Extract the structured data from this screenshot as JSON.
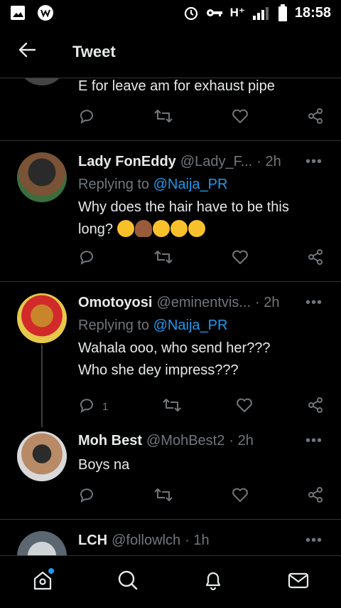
{
  "status_bar": {
    "network": "H⁺",
    "time": "18:58"
  },
  "header": {
    "title": "Tweet"
  },
  "tweets": [
    {
      "text": "E for leave am for exhaust pipe"
    },
    {
      "name": "Lady FonEddy",
      "handle": "@Lady_F...",
      "time": "· 2h",
      "replying_label": "Replying to ",
      "replying_handle": "@Naija_PR",
      "text": "Why does the hair have to be this long?"
    },
    {
      "name": "Omotoyosi",
      "handle": "@eminentvis...",
      "time": "· 2h",
      "replying_label": "Replying to ",
      "replying_handle": "@Naija_PR",
      "text_line1": "Wahala ooo, who send her???",
      "text_line2": "Who she dey impress???",
      "reply_count": "1"
    },
    {
      "name": "Moh Best",
      "handle": "@MohBest2",
      "time": "· 2h",
      "text": "Boys na"
    },
    {
      "name": "LCH",
      "handle": "@followlch",
      "time": "· 1h"
    }
  ],
  "more_label": "•••",
  "icons": [
    "back-arrow-icon",
    "home-icon",
    "search-icon",
    "bell-icon",
    "mail-icon",
    "reply-icon",
    "retweet-icon",
    "like-icon",
    "share-icon"
  ],
  "colors": {
    "background": "#000000",
    "text": "#e7e9ea",
    "secondary": "#71767b",
    "accent": "#1d9bf0",
    "divider": "#2f3336"
  }
}
